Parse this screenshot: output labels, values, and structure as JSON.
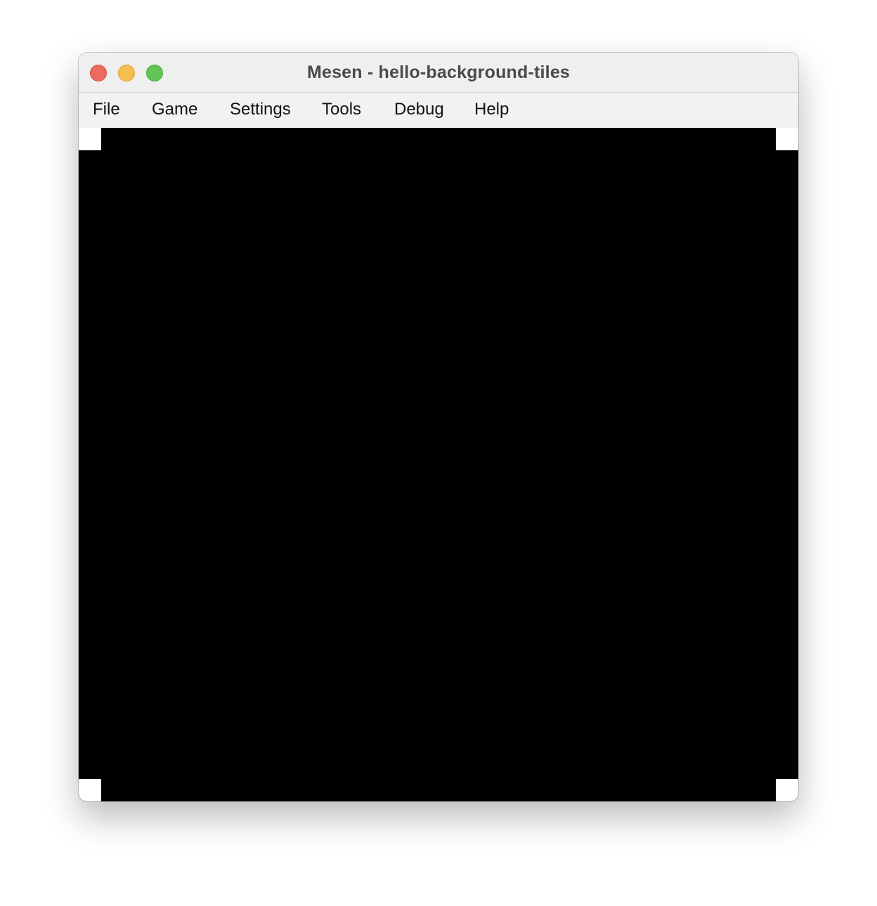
{
  "window": {
    "title": "Mesen - hello-background-tiles"
  },
  "window_controls": {
    "close_color": "#ed6a5e",
    "minimize_color": "#f5be4f",
    "zoom_color": "#61c554"
  },
  "menubar": {
    "items": [
      {
        "label": "File"
      },
      {
        "label": "Game"
      },
      {
        "label": "Settings"
      },
      {
        "label": "Tools"
      },
      {
        "label": "Debug"
      },
      {
        "label": "Help"
      }
    ]
  },
  "screen": {
    "background_color": "#000000",
    "corner_color": "#ffffff"
  }
}
